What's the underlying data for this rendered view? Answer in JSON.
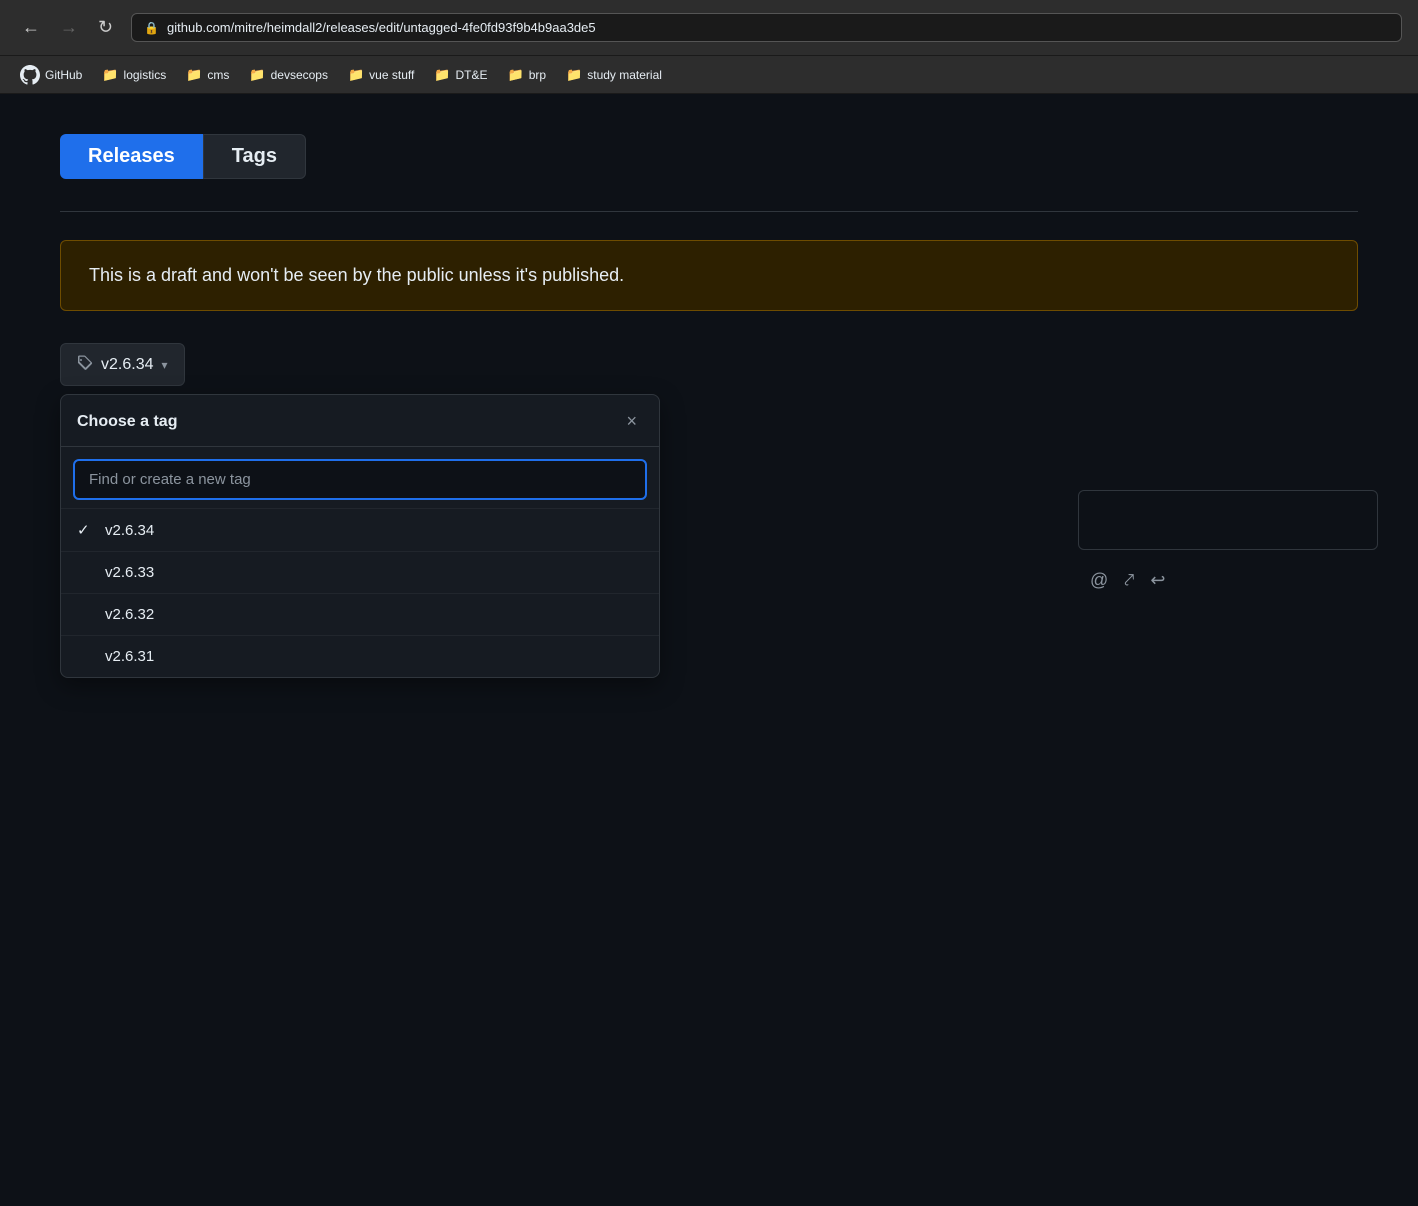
{
  "browser": {
    "url": "github.com/mitre/heimdall2/releases/edit/untagged-4fe0fd93f9b4b9aa3de5",
    "back_disabled": false,
    "forward_disabled": false
  },
  "bookmarks": {
    "github_label": "GitHub",
    "items": [
      {
        "id": "logistics",
        "label": "logistics"
      },
      {
        "id": "cms",
        "label": "cms"
      },
      {
        "id": "devsecops",
        "label": "devsecops"
      },
      {
        "id": "vue-stuff",
        "label": "vue stuff"
      },
      {
        "id": "dte",
        "label": "DT&E"
      },
      {
        "id": "brp",
        "label": "brp"
      },
      {
        "id": "study-material",
        "label": "study material"
      }
    ]
  },
  "tabs": {
    "releases": {
      "label": "Releases",
      "active": true
    },
    "tags": {
      "label": "Tags",
      "active": false
    }
  },
  "draft_notice": {
    "text": "This is a draft and won't be seen by the public unless it's published."
  },
  "tag_button": {
    "current_tag": "v2.6.34",
    "icon": "🏷"
  },
  "dropdown": {
    "title": "Choose a tag",
    "search_placeholder": "Find or create a new tag",
    "close_label": "×",
    "items": [
      {
        "id": "v2634",
        "label": "v2.6.34",
        "selected": true
      },
      {
        "id": "v2633",
        "label": "v2.6.33",
        "selected": false
      },
      {
        "id": "v2632",
        "label": "v2.6.32",
        "selected": false
      },
      {
        "id": "v2631",
        "label": "v2.6.31",
        "selected": false
      }
    ]
  },
  "toolbar": {
    "at_icon": "@",
    "crossref_icon": "⤤",
    "reply_icon": "↩"
  }
}
